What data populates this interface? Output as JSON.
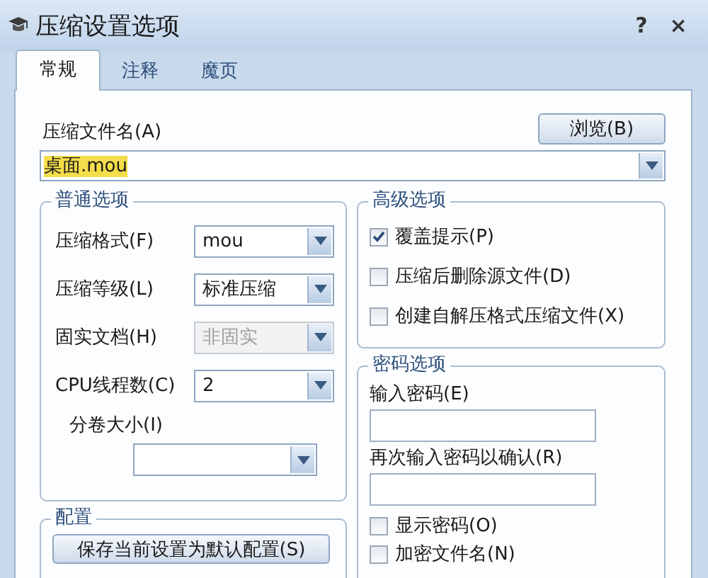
{
  "window": {
    "title": "压缩设置选项",
    "help": "?",
    "close": "×"
  },
  "tabs": [
    {
      "label": "常规",
      "selected": true
    },
    {
      "label": "注释",
      "selected": false
    },
    {
      "label": "魔页",
      "selected": false
    }
  ],
  "archive_name": {
    "label": "压缩文件名(A)",
    "browse_button": "浏览(B)",
    "value": "桌面.mou",
    "text_selected": true
  },
  "general_options": {
    "title": "普通选项",
    "fields": [
      {
        "kind": "inline",
        "label": "压缩格式(F)",
        "value": "mou",
        "disabled": false
      },
      {
        "kind": "inline",
        "label": "压缩等级(L)",
        "value": "标准压缩",
        "disabled": false
      },
      {
        "kind": "inline",
        "label": "固实文档(H)",
        "value": "非固实",
        "disabled": true
      },
      {
        "kind": "inline",
        "label": "CPU线程数(C)",
        "value": "2",
        "disabled": false
      },
      {
        "kind": "stacked",
        "label": "分卷大小(I)",
        "disabled": false
      }
    ]
  },
  "config": {
    "title": "配置",
    "button": "保存当前设置为默认配置(S)"
  },
  "advanced_options": {
    "title": "高级选项",
    "checkboxes": [
      {
        "label": "覆盖提示(P)",
        "checked": true
      },
      {
        "label": "压缩后删除源文件(D)",
        "checked": false
      },
      {
        "label": "创建自解压格式压缩文件(X)",
        "checked": false
      }
    ]
  },
  "password_options": {
    "title": "密码选项",
    "fields": [
      {
        "label": "输入密码(E)"
      },
      {
        "label": "再次输入密码以确认(R)"
      }
    ],
    "checkboxes": [
      {
        "label": "显示密码(O)",
        "checked": false
      },
      {
        "label": "加密文件名(N)",
        "checked": false
      }
    ]
  }
}
